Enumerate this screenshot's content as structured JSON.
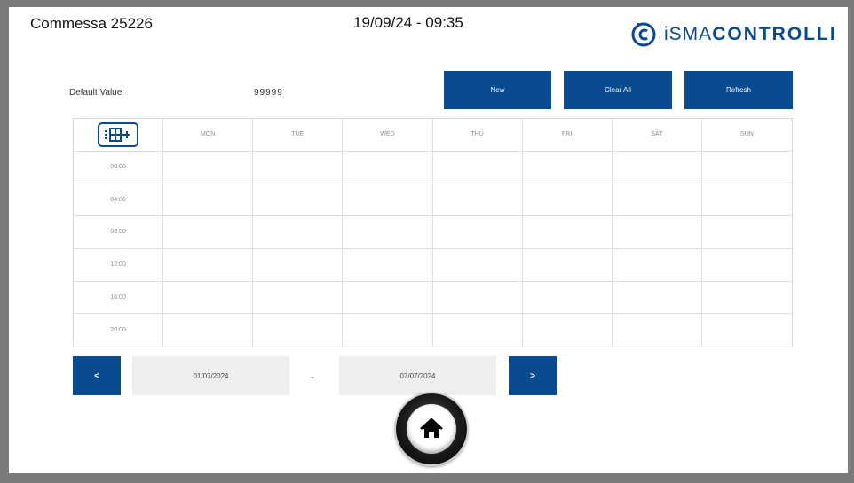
{
  "header": {
    "job_title": "Commessa 25226",
    "datetime": "19/09/24 - 09:35",
    "logo": {
      "prefix": "iSMA",
      "suffix": "CONTROLLI",
      "brand_color": "#0a4a8f"
    }
  },
  "default": {
    "label": "Default Value:",
    "value": "99999"
  },
  "toolbar": {
    "new_label": "New",
    "clear_label": "Clear All",
    "refresh_label": "Refresh"
  },
  "schedule": {
    "menu_icon": "schedule-grid-icon",
    "days": [
      "MON",
      "TUE",
      "WED",
      "THU",
      "FRI",
      "SAT",
      "SUN"
    ],
    "times": [
      "00:00",
      "04:00",
      "08:00",
      "12:00",
      "16:00",
      "20:00"
    ]
  },
  "range": {
    "prev_label": "<",
    "from": "01/07/2024",
    "separator": "-",
    "to": "07/07/2024",
    "next_label": ">"
  },
  "home": {
    "icon": "home-icon"
  },
  "colors": {
    "accent": "#0a4a8f",
    "background": "#7b7b7b",
    "panel": "#ffffff"
  }
}
